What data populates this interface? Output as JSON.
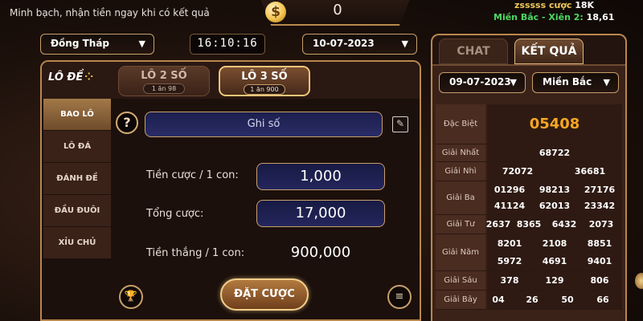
{
  "header": {
    "tagline": "Minh bạch, nhận tiền ngay khi có kết quả",
    "balance": "0",
    "coin_icon": "$",
    "ticker_user": "zsssss cược",
    "ticker_amount": "18K",
    "ticker_region": "Miền Bắc - Xiên 2:",
    "ticker_value": "18,61"
  },
  "controls": {
    "province": "Đồng Tháp",
    "clock": "16:10:16",
    "date": "10-07-2023"
  },
  "game": {
    "logo_text": "LÔ ĐỀ",
    "tabs": [
      {
        "label": "LÔ 2 SỐ",
        "sub": "1 ăn 98"
      },
      {
        "label": "LÔ 3 SỐ",
        "sub": "1 ăn 900"
      }
    ],
    "side_menu": [
      "BAO LÔ",
      "LÔ ĐÁ",
      "ĐÁNH ĐỀ",
      "ĐẦU ĐUÔI",
      "XỈU CHỦ"
    ],
    "note_placeholder": "Ghi số",
    "bet_per_label": "Tiền cược / 1 con:",
    "bet_per_value": "1,000",
    "total_label": "Tổng cược:",
    "total_value": "17,000",
    "win_label": "Tiền thắng / 1 con:",
    "win_value": "900,000",
    "bet_button": "ĐẶT CƯỢC"
  },
  "results": {
    "tabs": [
      "CHAT",
      "KẾT QUẢ"
    ],
    "date": "09-07-2023",
    "region": "Miền Bắc",
    "rows": [
      {
        "label": "Đặc Biệt",
        "values": [
          "05408"
        ]
      },
      {
        "label": "Giải Nhất",
        "values": [
          "68722"
        ]
      },
      {
        "label": "Giải Nhì",
        "values": [
          "72072",
          "36681"
        ]
      },
      {
        "label": "Giải Ba",
        "values": [
          "01296",
          "98213",
          "27176",
          "41124",
          "62013",
          "23342"
        ]
      },
      {
        "label": "Giải Tư",
        "values": [
          "2637",
          "8365",
          "6432",
          "2073"
        ]
      },
      {
        "label": "Giải Năm",
        "values": [
          "8201",
          "2108",
          "8851",
          "5972",
          "4691",
          "9401"
        ]
      },
      {
        "label": "Giải Sáu",
        "values": [
          "378",
          "129",
          "806"
        ]
      },
      {
        "label": "Giải Bảy",
        "values": [
          "04",
          "26",
          "50",
          "66"
        ]
      }
    ]
  },
  "colors": {
    "accent_gold": "#c8a06a",
    "special_prize": "#f5a623",
    "ticker_green": "#4cd963"
  },
  "icons": [
    "coin-icon",
    "help-icon",
    "edit-icon",
    "trophy-icon",
    "receipt-icon",
    "chevron-down-icon"
  ]
}
